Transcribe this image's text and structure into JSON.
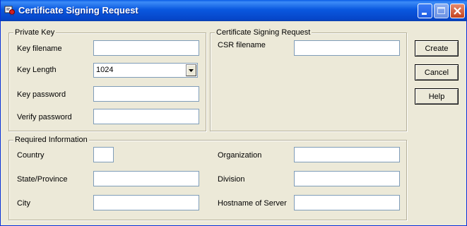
{
  "window": {
    "title": "Certificate Signing Request"
  },
  "private_key": {
    "group_label": "Private Key",
    "key_filename_label": "Key filename",
    "key_filename_value": "",
    "key_length_label": "Key Length",
    "key_length_value": "1024",
    "key_password_label": "Key password",
    "key_password_value": "",
    "verify_password_label": "Verify password",
    "verify_password_value": ""
  },
  "csr": {
    "group_label": "Certificate Signing Request",
    "csr_filename_label": "CSR filename",
    "csr_filename_value": ""
  },
  "required_info": {
    "group_label": "Required Information",
    "country_label": "Country",
    "state_label": "State/Province",
    "city_label": "City",
    "organization_label": "Organization",
    "division_label": "Division",
    "hostname_label": "Hostname of Server"
  },
  "buttons": {
    "create": "Create",
    "cancel": "Cancel",
    "help": "Help"
  },
  "colors": {
    "titlebar": "#0a58df",
    "dialog_bg": "#ece9d8",
    "field_border": "#7f9db9"
  }
}
